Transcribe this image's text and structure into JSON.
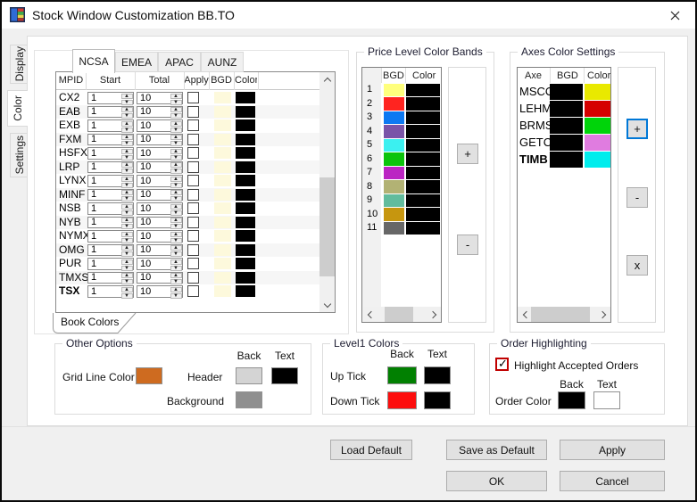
{
  "window": {
    "title": "Stock Window Customization BB.TO"
  },
  "side_tabs": [
    {
      "label": "Display",
      "active": false
    },
    {
      "label": "Color",
      "active": true
    },
    {
      "label": "Settings",
      "active": false
    }
  ],
  "book": {
    "market_tabs": [
      "NCSA",
      "EMEA",
      "APAC",
      "AUNZ"
    ],
    "columns": {
      "mpid": "MPID",
      "start": "Start",
      "total": "Total",
      "apply": "Apply",
      "bgd": "BGD",
      "color": "Color"
    },
    "bottom_tab_label": "Book Colors",
    "rows": [
      {
        "mpid": "CX2",
        "start": "1",
        "total": "10",
        "apply": false,
        "bgd": "#FDF9DC",
        "color": "#000000",
        "bold": false
      },
      {
        "mpid": "EAB",
        "start": "1",
        "total": "10",
        "apply": false,
        "bgd": "#FDF9DC",
        "color": "#000000",
        "bold": false
      },
      {
        "mpid": "EXB",
        "start": "1",
        "total": "10",
        "apply": false,
        "bgd": "#FDF9DC",
        "color": "#000000",
        "bold": false
      },
      {
        "mpid": "FXM",
        "start": "1",
        "total": "10",
        "apply": false,
        "bgd": "#FDF9DC",
        "color": "#000000",
        "bold": false
      },
      {
        "mpid": "HSFX",
        "start": "1",
        "total": "10",
        "apply": false,
        "bgd": "#FDF9DC",
        "color": "#000000",
        "bold": false
      },
      {
        "mpid": "LRP",
        "start": "1",
        "total": "10",
        "apply": false,
        "bgd": "#FDF9DC",
        "color": "#000000",
        "bold": false
      },
      {
        "mpid": "LYNX",
        "start": "1",
        "total": "10",
        "apply": false,
        "bgd": "#FDF9DC",
        "color": "#000000",
        "bold": false
      },
      {
        "mpid": "MINF",
        "start": "1",
        "total": "10",
        "apply": false,
        "bgd": "#FDF9DC",
        "color": "#000000",
        "bold": false
      },
      {
        "mpid": "NSB",
        "start": "1",
        "total": "10",
        "apply": false,
        "bgd": "#FDF9DC",
        "color": "#000000",
        "bold": false
      },
      {
        "mpid": "NYB",
        "start": "1",
        "total": "10",
        "apply": false,
        "bgd": "#FDF9DC",
        "color": "#000000",
        "bold": false
      },
      {
        "mpid": "NYMX",
        "start": "1",
        "total": "10",
        "apply": false,
        "bgd": "#FDF9DC",
        "color": "#000000",
        "bold": false
      },
      {
        "mpid": "OMG",
        "start": "1",
        "total": "10",
        "apply": false,
        "bgd": "#FDF9DC",
        "color": "#000000",
        "bold": false
      },
      {
        "mpid": "PUR",
        "start": "1",
        "total": "10",
        "apply": false,
        "bgd": "#FDF9DC",
        "color": "#000000",
        "bold": false
      },
      {
        "mpid": "TMXS",
        "start": "1",
        "total": "10",
        "apply": false,
        "bgd": "#FDF9DC",
        "color": "#000000",
        "bold": false
      },
      {
        "mpid": "TSX",
        "start": "1",
        "total": "10",
        "apply": false,
        "bgd": "#FDF9DC",
        "color": "#000000",
        "bold": true
      }
    ]
  },
  "price_bands": {
    "title": "Price Level Color Bands",
    "columns": {
      "bgd": "BGD",
      "color": "Color"
    },
    "add_label": "+",
    "remove_label": "-",
    "rows": [
      {
        "num": "1",
        "bgd": "#FFFF7D",
        "color": "#000000"
      },
      {
        "num": "2",
        "bgd": "#FF2420",
        "color": "#000000"
      },
      {
        "num": "3",
        "bgd": "#0D79F2",
        "color": "#000000"
      },
      {
        "num": "4",
        "bgd": "#7A54A8",
        "color": "#000000"
      },
      {
        "num": "5",
        "bgd": "#3BF0F0",
        "color": "#000000"
      },
      {
        "num": "6",
        "bgd": "#0CC40C",
        "color": "#000000"
      },
      {
        "num": "7",
        "bgd": "#BB25C3",
        "color": "#000000"
      },
      {
        "num": "8",
        "bgd": "#B2B274",
        "color": "#000000"
      },
      {
        "num": "9",
        "bgd": "#62BC9D",
        "color": "#000000"
      },
      {
        "num": "10",
        "bgd": "#C6960F",
        "color": "#000000"
      },
      {
        "num": "11",
        "bgd": "#676767",
        "color": "#000000"
      }
    ]
  },
  "axes": {
    "title": "Axes Color Settings",
    "columns": {
      "axe": "Axe",
      "bgd": "BGD",
      "color": "Color"
    },
    "add_label": "+",
    "remove_label": "-",
    "delete_label": "x",
    "rows": [
      {
        "axe": "MSCO",
        "bgd": "#000000",
        "color": "#E9E900",
        "bold": false
      },
      {
        "axe": "LEHM",
        "bgd": "#000000",
        "color": "#D50000",
        "bold": false
      },
      {
        "axe": "BRMS",
        "bgd": "#000000",
        "color": "#00D40A",
        "bold": false
      },
      {
        "axe": "GETC",
        "bgd": "#000000",
        "color": "#E07CE0",
        "bold": false
      },
      {
        "axe": "TIMB",
        "bgd": "#000000",
        "color": "#00EDED",
        "bold": true
      }
    ]
  },
  "other_options": {
    "title": "Other Options",
    "back_header": "Back",
    "text_header": "Text",
    "grid_line_label": "Grid Line Color",
    "grid_line_color": "#CE6B20",
    "header_label": "Header",
    "header_back": "#D4D4D4",
    "header_text": "#000000",
    "background_label": "Background",
    "background_color": "#8F8F8F"
  },
  "level1_colors": {
    "title": "Level1 Colors",
    "back_header": "Back",
    "text_header": "Text",
    "rows": [
      {
        "label": "Up Tick",
        "back": "#018001",
        "text": "#000000"
      },
      {
        "label": "Down Tick",
        "back": "#FD0D0D",
        "text": "#000000"
      }
    ]
  },
  "order_highlighting": {
    "title": "Order Highlighting",
    "checkbox_label": "Highlight Accepted Orders",
    "checked": true,
    "checkbox_accent": "#C00000",
    "back_header": "Back",
    "text_header": "Text",
    "order_color_label": "Order Color",
    "order_back": "#000000",
    "order_text": "#FFFFFF"
  },
  "footer": {
    "load_default": "Load Default",
    "save_as_default": "Save as Default",
    "apply": "Apply",
    "ok": "OK",
    "cancel": "Cancel"
  }
}
